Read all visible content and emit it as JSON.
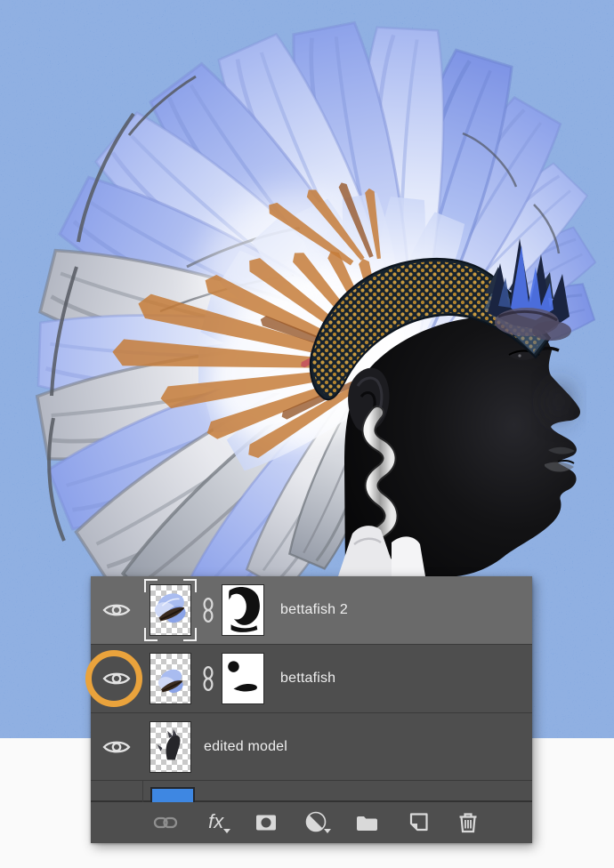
{
  "scene": {
    "background_color": "#5688d4",
    "floor_color": "#fafafa",
    "artwork_subject": "Profile portrait of a model with a blue betta-fish-fin mohawk collage on a blue grainy background"
  },
  "layers_panel": {
    "rows": [
      {
        "name": "bettafish 2",
        "selected": true,
        "visible": true,
        "has_mask": true,
        "linked": true
      },
      {
        "name": "bettafish",
        "selected": false,
        "visible": true,
        "has_mask": true,
        "linked": true
      },
      {
        "name": "edited model",
        "selected": false,
        "visible": true,
        "has_mask": false,
        "linked": false
      }
    ],
    "partial_layer": {
      "thumbnail_color": "#3e87e2"
    },
    "toolbar": {
      "fx_label": "fx",
      "icons": [
        "link-layers-icon",
        "layer-styles-icon",
        "add-layer-mask-icon",
        "new-adjustment-layer-icon",
        "new-group-icon",
        "new-layer-icon",
        "delete-layer-icon"
      ]
    },
    "colors": {
      "row_selected": "#6a6a6a",
      "row": "#4e4e4e",
      "text": "#efefef",
      "divider": "#3a3a3a"
    }
  },
  "annotation": {
    "highlight_ring_color": "#eaa33c",
    "highlighted_control": "bettafish layer visibility eye"
  }
}
